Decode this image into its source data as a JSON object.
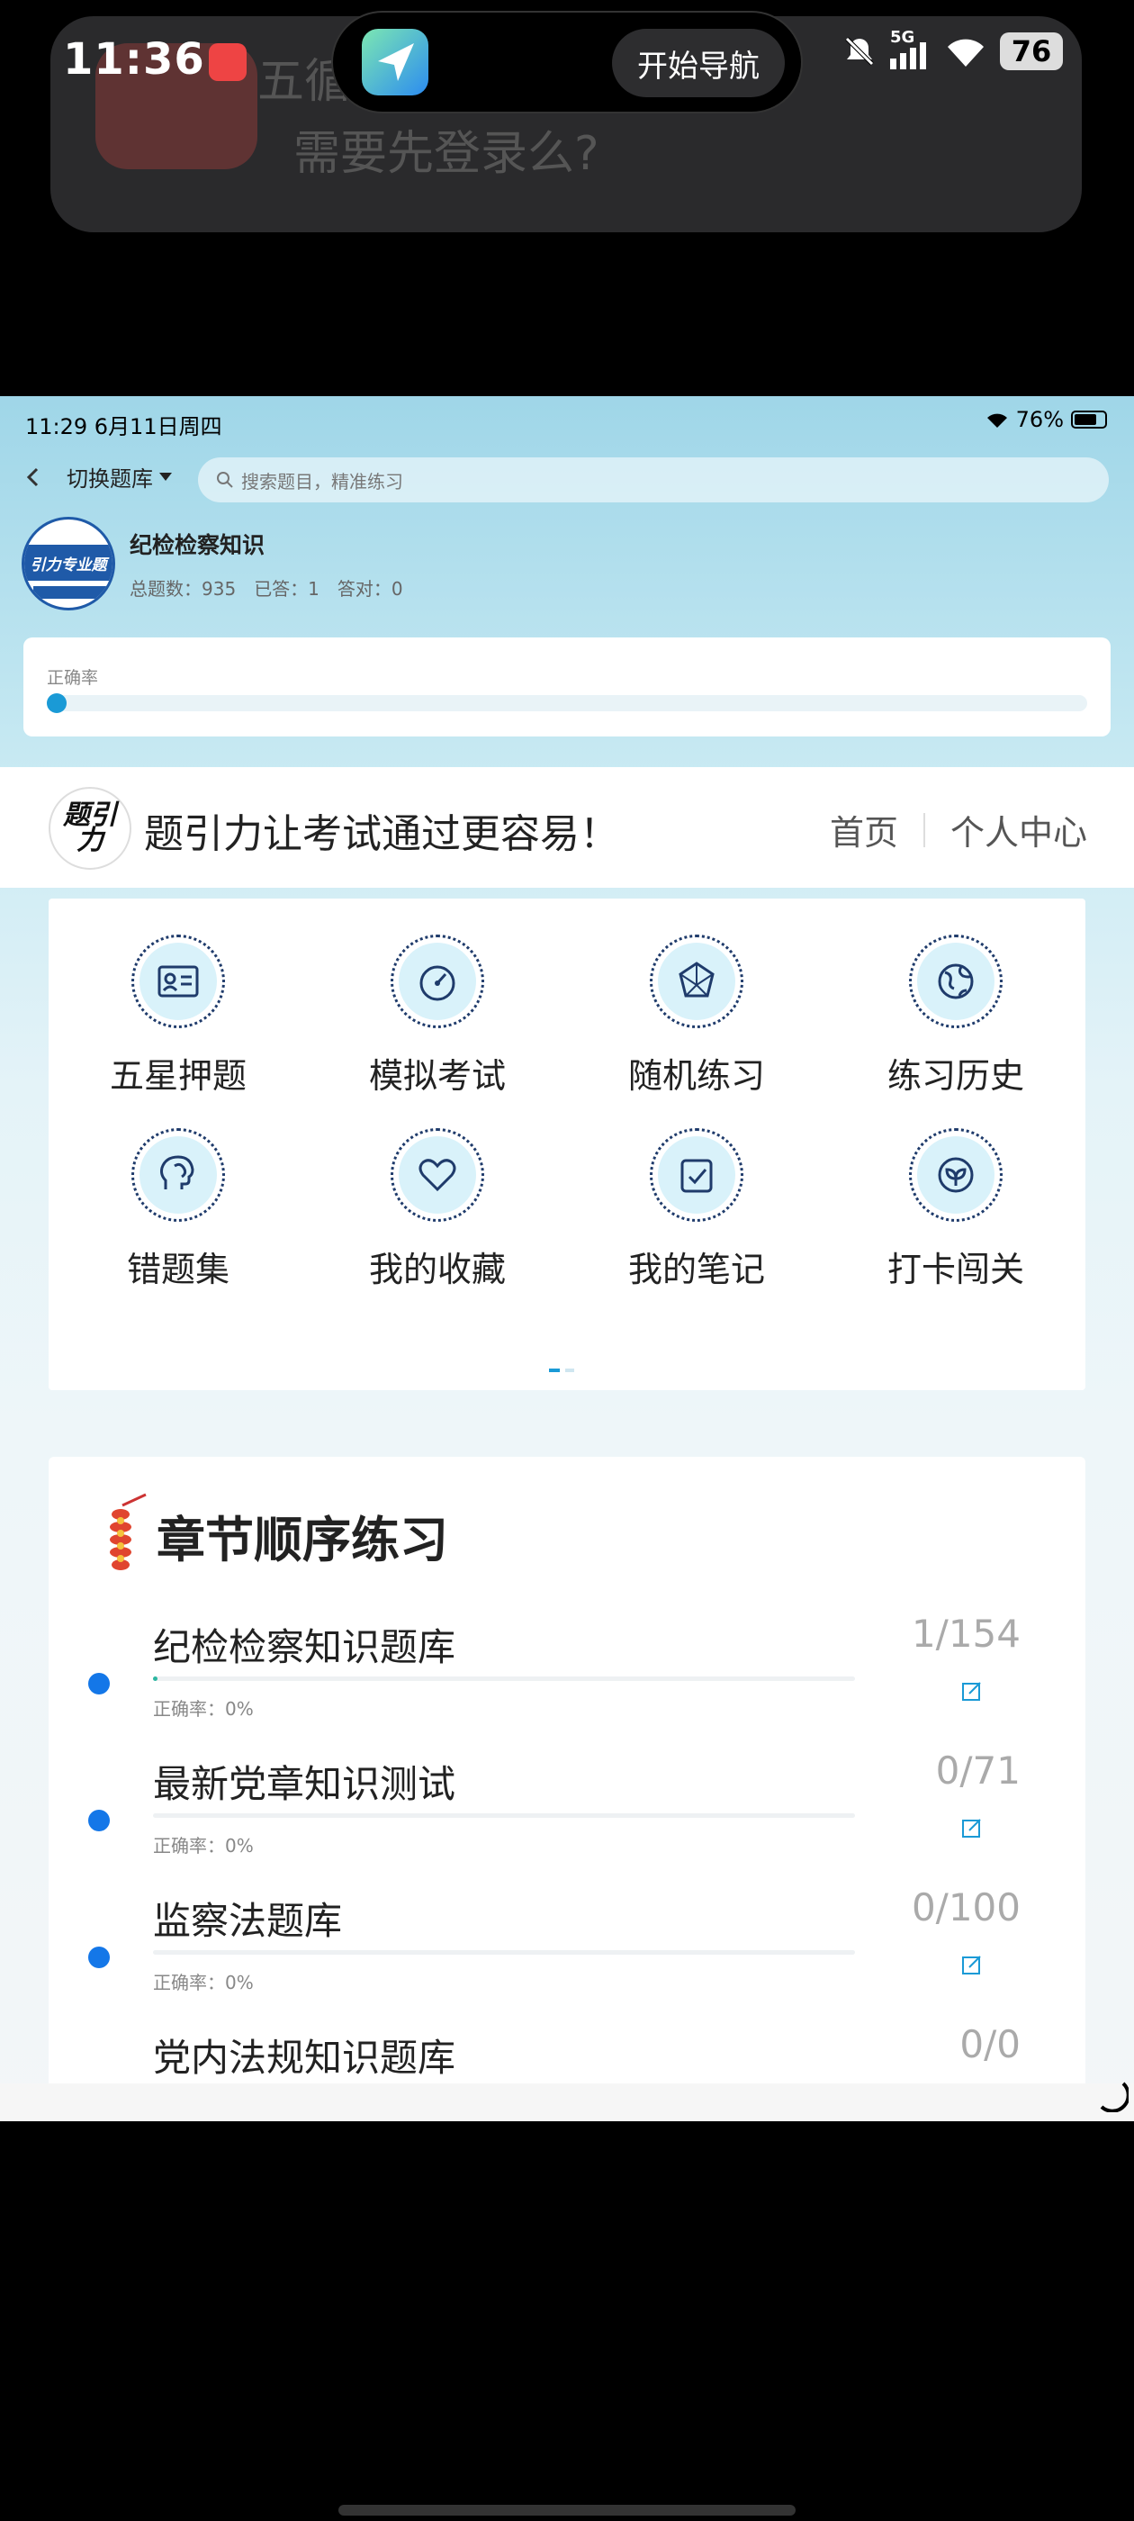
{
  "phone": {
    "time": "11:36",
    "notification": {
      "title": "五循",
      "body": "需要先登录么?"
    },
    "island_button": "开始导航",
    "network": "5G",
    "battery": "76"
  },
  "app": {
    "status": {
      "time_date": "11:29   6月11日周四",
      "battery_pct": "76%"
    },
    "nav": {
      "switch_label": "切换题库",
      "search_placeholder": "搜索题目，精准练习"
    },
    "bank": {
      "logo_text": "引力专业题",
      "name": "纪检检察知识",
      "total": "总题数：935",
      "answered": "已答：1",
      "correct": "答对：0"
    },
    "rate": {
      "label": "正确率",
      "value_fraction": 0.0
    },
    "brand": {
      "logo_text": "题引力",
      "slogan": "题引力让考试通过更容易！",
      "nav_home": "首页",
      "nav_profile": "个人中心"
    },
    "features": [
      {
        "label": "五星押题",
        "icon": "id-card-icon"
      },
      {
        "label": "模拟考试",
        "icon": "speedometer-icon"
      },
      {
        "label": "随机练习",
        "icon": "dice-icon"
      },
      {
        "label": "练习历史",
        "icon": "globe-icon"
      },
      {
        "label": "错题集",
        "icon": "brain-icon"
      },
      {
        "label": "我的收藏",
        "icon": "heart-icon"
      },
      {
        "label": "我的笔记",
        "icon": "note-check-icon"
      },
      {
        "label": "打卡闯关",
        "icon": "leaf-icon"
      }
    ],
    "chapters": {
      "title": "章节顺序练习",
      "items": [
        {
          "name": "纪检检察知识题库",
          "rate": "正确率：0%",
          "count": "1/154",
          "progress": 0.0065
        },
        {
          "name": "最新党章知识测试",
          "rate": "正确率：0%",
          "count": "0/71",
          "progress": 0
        },
        {
          "name": "监察法题库",
          "rate": "正确率：0%",
          "count": "0/100",
          "progress": 0
        },
        {
          "name": "党内法规知识题库",
          "rate": "",
          "count": "0/0",
          "progress": 0
        }
      ]
    }
  },
  "colors": {
    "accent": "#1a9ad6",
    "dot": "#1477e8",
    "icon_stroke": "#1f3b6b"
  }
}
